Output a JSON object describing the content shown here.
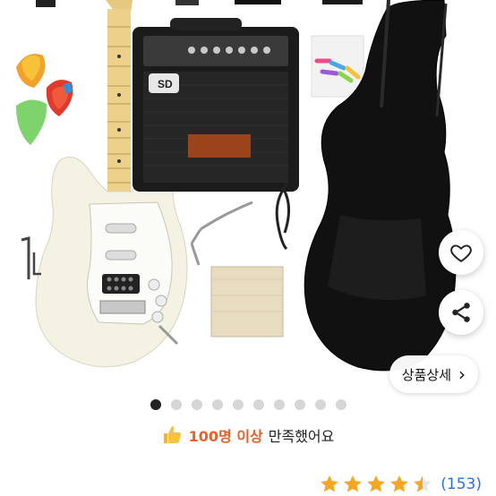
{
  "product": {
    "amp_brand": "SD",
    "detail_button": {
      "label": "상품상세",
      "chevron": "›"
    },
    "favorite_icon": "heart-icon",
    "share_icon": "share-icon"
  },
  "gallery": {
    "total": 10,
    "active_index": 0
  },
  "satisfaction": {
    "icon": "thumbs-up-icon",
    "highlight": "100명 이상",
    "text": "만족했어요"
  },
  "rating": {
    "stars": 4.5,
    "count": "(153)"
  },
  "colors": {
    "accent": "#e8612c",
    "link": "#2f6fe0",
    "star": "#f5a623"
  }
}
